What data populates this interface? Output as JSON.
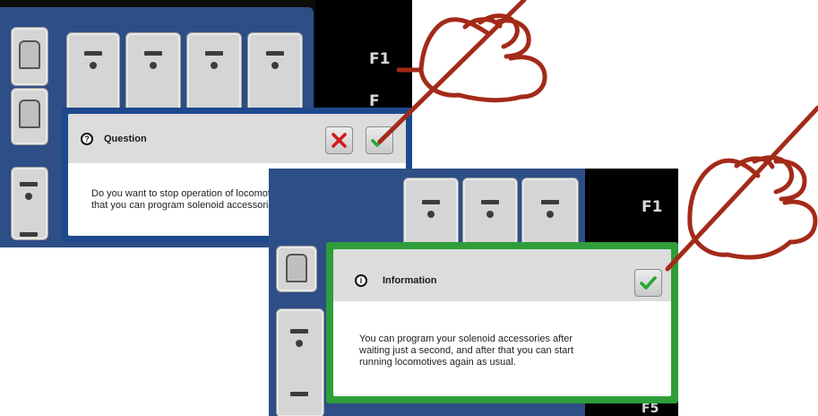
{
  "screen1": {
    "fkeys": [
      "F1",
      "F"
    ],
    "dialog": {
      "icon": "question-icon",
      "title": "Question",
      "message_lines": [
        "Do you want to stop operation of locomotives, so",
        "that you can program solenoid accessories?"
      ],
      "cancel_icon": "close-icon",
      "confirm_icon": "checkmark-icon"
    }
  },
  "screen2": {
    "fkeys": [
      "F1",
      "F5"
    ],
    "dialog": {
      "icon": "info-icon",
      "title": "Information",
      "message_lines": [
        "You can program your solenoid accessories after",
        "waiting just a second, and after that you can start",
        "running locomotives again as usual."
      ],
      "confirm_icon": "checkmark-icon"
    }
  },
  "colors": {
    "question_border": "#1d4a8c",
    "info_border": "#2e9d3a",
    "accessory_frame": "#2d4e86",
    "pen_hand": "#a32a18",
    "close_red": "#d21a1a",
    "check_green": "#27a833"
  }
}
